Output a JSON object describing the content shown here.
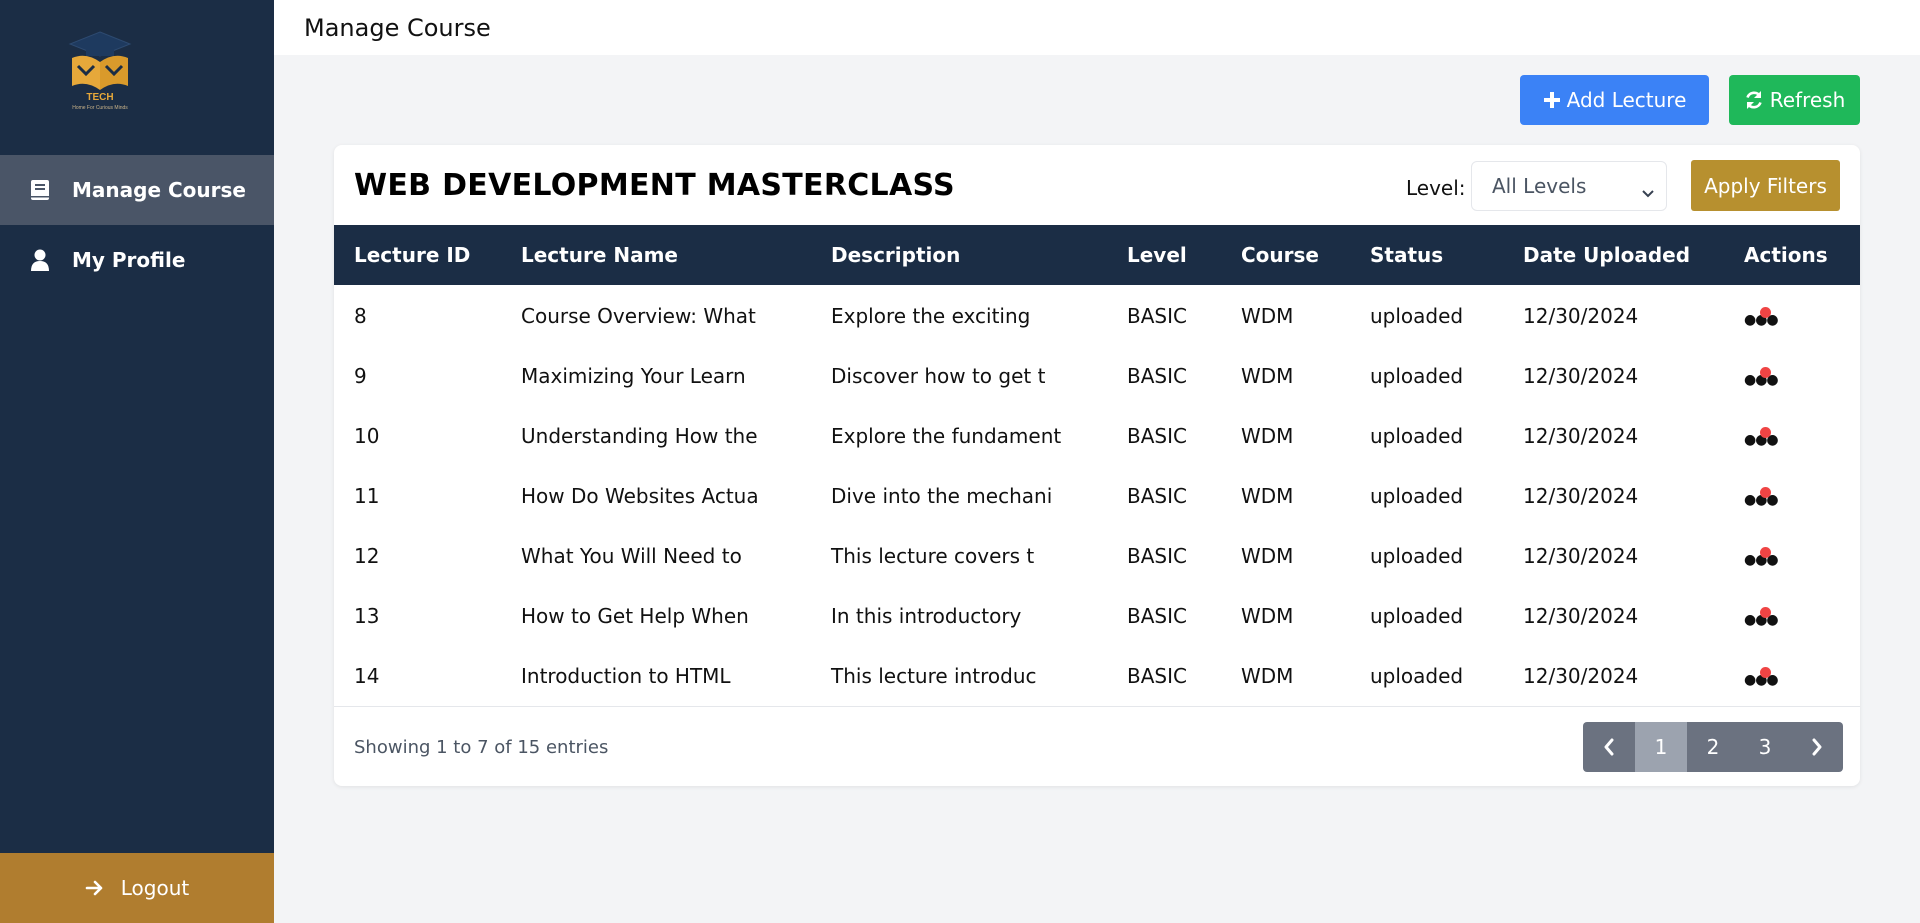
{
  "app": {
    "logo_text": "TECH",
    "logo_tagline": "Home For Curious Minds"
  },
  "sidebar": {
    "items": [
      {
        "label": "Manage Course",
        "icon": "book-icon",
        "active": true
      },
      {
        "label": "My Profile",
        "icon": "user-icon",
        "active": false
      }
    ],
    "logout_label": "Logout"
  },
  "header": {
    "title": "Manage Course"
  },
  "toolbar": {
    "add_label": "Add Lecture",
    "refresh_label": "Refresh"
  },
  "course": {
    "title": "WEB DEVELOPMENT MASTERCLASS",
    "level_label": "Level:",
    "level_selected": "All Levels",
    "apply_label": "Apply Filters"
  },
  "table": {
    "columns": [
      "Lecture ID",
      "Lecture Name",
      "Description",
      "Level",
      "Course",
      "Status",
      "Date Uploaded",
      "Actions"
    ],
    "rows": [
      [
        "8",
        "Course Overview: What",
        "Explore the exciting",
        "BASIC",
        "WDM",
        "uploaded",
        "12/30/2024"
      ],
      [
        "9",
        "Maximizing Your Learn",
        "Discover how to get t",
        "BASIC",
        "WDM",
        "uploaded",
        "12/30/2024"
      ],
      [
        "10",
        "Understanding How the",
        "Explore the fundament",
        "BASIC",
        "WDM",
        "uploaded",
        "12/30/2024"
      ],
      [
        "11",
        "How Do Websites Actua",
        "Dive into the mechani",
        "BASIC",
        "WDM",
        "uploaded",
        "12/30/2024"
      ],
      [
        "12",
        "What You Will Need to",
        "This lecture covers t",
        "BASIC",
        "WDM",
        "uploaded",
        "12/30/2024"
      ],
      [
        "13",
        "How to Get Help When",
        "In this introductory",
        "BASIC",
        "WDM",
        "uploaded",
        "12/30/2024"
      ],
      [
        "14",
        "Introduction to HTML",
        "This lecture introduc",
        "BASIC",
        "WDM",
        "uploaded",
        "12/30/2024"
      ]
    ]
  },
  "footer": {
    "showing": "Showing 1 to 7 of 15 entries",
    "pages": [
      "1",
      "2",
      "3"
    ],
    "current_page": "1"
  },
  "colors": {
    "sidebar": "#1b2d45",
    "logout": "#b07d2f",
    "add": "#3b82f6",
    "refresh": "#1fb85a",
    "apply": "#b7902f",
    "pager": "#6b7280"
  }
}
